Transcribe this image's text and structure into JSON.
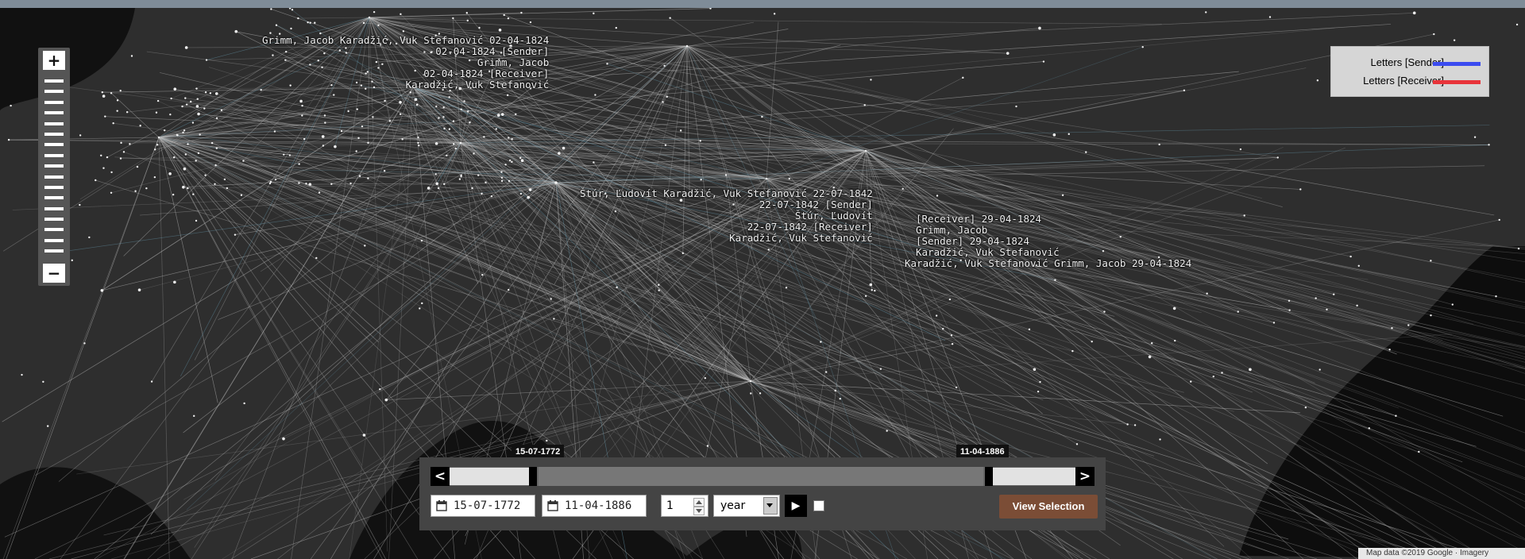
{
  "zoom": {
    "in_label": "+",
    "out_label": "−",
    "steps": 17
  },
  "legend": {
    "sender": {
      "label": "Letters [Sender]",
      "color": "#3b4cf0"
    },
    "receiver": {
      "label": "Letters [Receiver]",
      "color": "#e8343a"
    }
  },
  "map_labels": [
    {
      "id": "grimm-1824-a",
      "lines": [
        "Grimm, Jacob Karadžić, Vuk Stefanović 02-04-1824",
        "02-04-1824 [Sender]",
        "Grimm, Jacob",
        "02-04-1824 [Receiver]",
        "Karadžić, Vuk Stefanović"
      ]
    },
    {
      "id": "stur-1842",
      "lines": [
        "Štúr, Ľudovít Karadžić, Vuk Stefanović 22-07-1842",
        "22-07-1842 [Sender]",
        "Štúr, Ľudovít",
        "22-07-1842 [Receiver]",
        "Karadžić, Vuk Stefanović"
      ]
    },
    {
      "id": "grimm-1824-b",
      "lines": [
        "[Receiver] 29-04-1824",
        "Grimm, Jacob",
        "[Sender] 29-04-1824",
        "Karadžić, Vuk Stefanović",
        "Karadžić, Vuk Stefanović Grimm, Jacob 29-04-1824"
      ]
    }
  ],
  "timeline": {
    "start_handle": "15-07-1772",
    "end_handle": "11-04-1886",
    "prev_label": "<",
    "next_label": ">",
    "start_date": "15-07-1772",
    "end_date": "11-04-1886",
    "step_value": "1",
    "step_unit": "year",
    "play_label": "▶",
    "view_selection_label": "View Selection"
  },
  "attribution": "Map data ©2019 Google  ·  Imagery"
}
